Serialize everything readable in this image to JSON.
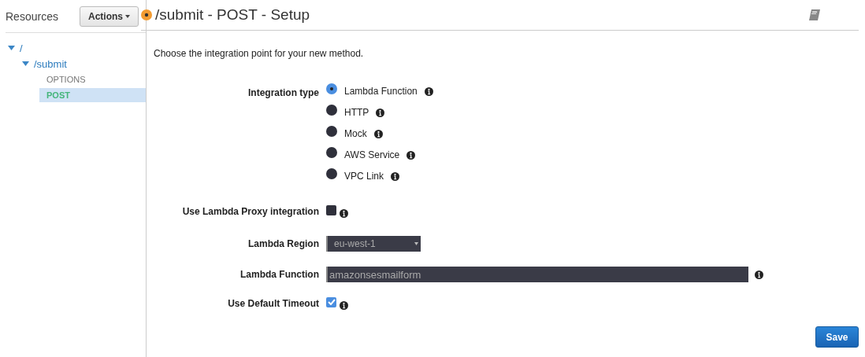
{
  "sidebar": {
    "title": "Resources",
    "actions_button": "Actions",
    "tree": [
      {
        "label": "/",
        "kind": "resource",
        "expanded": true,
        "selected": false,
        "children": [
          {
            "label": "/submit",
            "kind": "resource",
            "expanded": true,
            "selected": false,
            "children": [
              {
                "label": "OPTIONS",
                "kind": "method",
                "selected": false
              },
              {
                "label": "POST",
                "kind": "method",
                "selected": true
              }
            ]
          }
        ]
      }
    ]
  },
  "header": {
    "title": "/submit - POST - Setup"
  },
  "intro": "Choose the integration point for your new method.",
  "integration_type": {
    "label": "Integration type",
    "options": [
      {
        "label": "Lambda Function",
        "selected": true
      },
      {
        "label": "HTTP",
        "selected": false
      },
      {
        "label": "Mock",
        "selected": false
      },
      {
        "label": "AWS Service",
        "selected": false
      },
      {
        "label": "VPC Link",
        "selected": false
      }
    ]
  },
  "proxy": {
    "label": "Use Lambda Proxy integration",
    "checked": false
  },
  "region": {
    "label": "Lambda Region",
    "value": "eu-west-1"
  },
  "lambda_function": {
    "label": "Lambda Function",
    "value": "amazonsesmailform"
  },
  "timeout": {
    "label": "Use Default Timeout",
    "checked": true
  },
  "save_button": "Save"
}
